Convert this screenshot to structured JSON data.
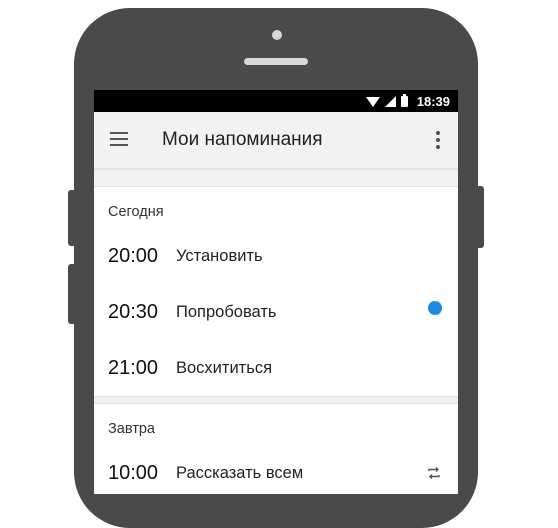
{
  "status_bar": {
    "time": "18:39"
  },
  "app_bar": {
    "title": "Мои напоминания"
  },
  "sections": [
    {
      "header": "Сегодня",
      "items": [
        {
          "time": "20:00",
          "label": "Установить"
        },
        {
          "time": "20:30",
          "label": "Попробовать",
          "indicator": "unread-dot",
          "indicator_color": "#1e88e5"
        },
        {
          "time": "21:00",
          "label": "Восхититься"
        }
      ]
    },
    {
      "header": "Завтра",
      "items": [
        {
          "time": "10:00",
          "label": "Рассказать всем",
          "indicator": "repeat-icon"
        }
      ]
    }
  ],
  "colors": {
    "phone_body": "#4a4a4a",
    "app_bar": "#f2f2f2",
    "accent_dot": "#1e88e5"
  }
}
